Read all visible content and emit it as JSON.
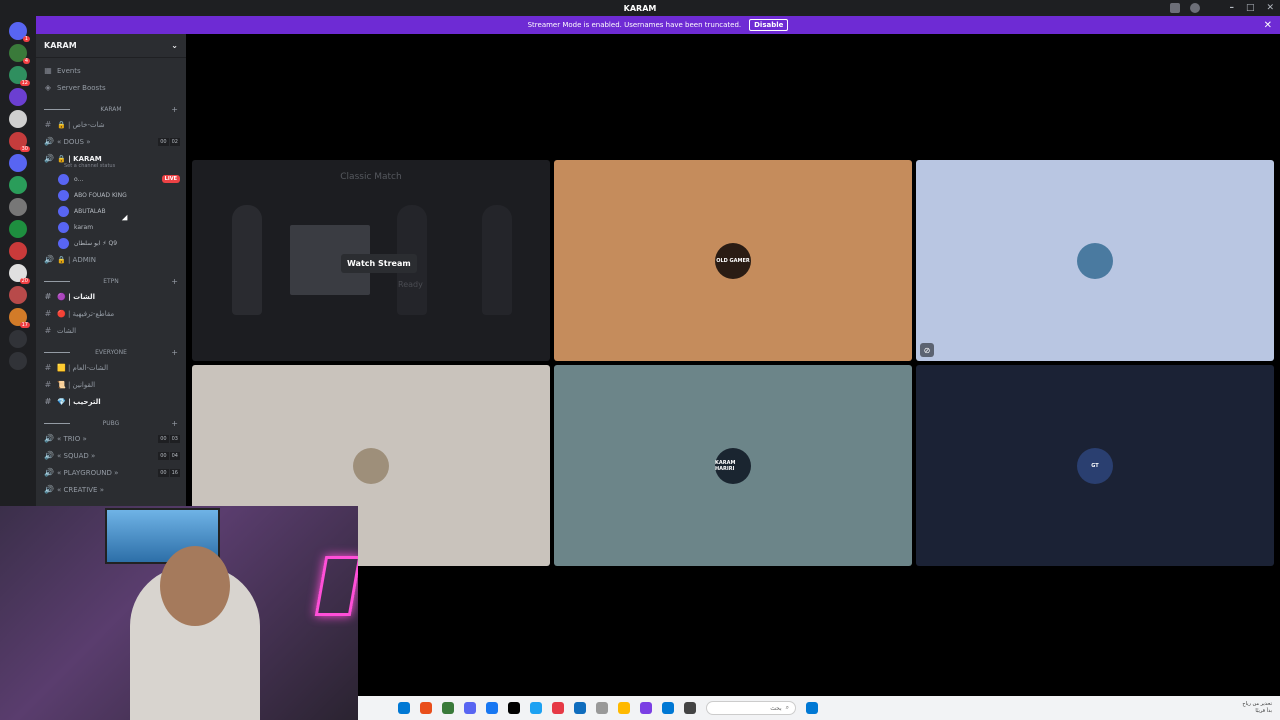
{
  "window": {
    "title": "KARAM"
  },
  "banner": {
    "text": "Streamer Mode is enabled. Usernames have been truncated.",
    "disable_label": "Disable"
  },
  "guilds": [
    {
      "color": "#5865f2",
      "badge": "1"
    },
    {
      "color": "#3a7a3a",
      "badge": "4"
    },
    {
      "color": "#2f8f5f",
      "badge": "12"
    },
    {
      "color": "#6b3fd1",
      "badge": ""
    },
    {
      "color": "#cfcfcf",
      "badge": ""
    },
    {
      "color": "#c43c3c",
      "badge": "30"
    },
    {
      "color": "#5865f2",
      "badge": ""
    },
    {
      "color": "#2a9d5a",
      "badge": ""
    },
    {
      "color": "#777",
      "badge": ""
    },
    {
      "color": "#1e8f3f",
      "badge": ""
    },
    {
      "color": "#c93a3a",
      "badge": ""
    },
    {
      "color": "#e0e0e0",
      "badge": "20"
    },
    {
      "color": "#b84a4a",
      "badge": ""
    },
    {
      "color": "#d27b28",
      "badge": "17"
    },
    {
      "color": "#313338",
      "badge": ""
    },
    {
      "color": "#313338",
      "badge": ""
    }
  ],
  "sidebar": {
    "server_name": "KARAM",
    "top_items": [
      {
        "icon": "calendar-icon",
        "label": "Events"
      },
      {
        "icon": "boost-icon",
        "label": "Server Boosts"
      }
    ],
    "categories": [
      {
        "name": "KARAM",
        "channels": [
          {
            "type": "text",
            "label": "🔒 | شات-خاص",
            "bright": false,
            "counts": []
          },
          {
            "type": "voice",
            "label": "« DOUS »",
            "bright": false,
            "counts": [
              "00",
              "02"
            ]
          },
          {
            "type": "voice",
            "label": "🔒 | KARAM",
            "bright": true,
            "counts": [],
            "status": "Set a channel status",
            "users": [
              {
                "name": "o...",
                "live": true
              },
              {
                "name": "ABO FOUAD KING",
                "live": false
              },
              {
                "name": "ABUTALAB",
                "live": false
              },
              {
                "name": "karam",
                "live": false
              },
              {
                "name": "ابو سلطان ⚡ Q9",
                "live": false
              }
            ]
          },
          {
            "type": "voice",
            "label": "🔒 | ADMIN",
            "bright": false,
            "counts": []
          }
        ]
      },
      {
        "name": "ETPN",
        "channels": [
          {
            "type": "text",
            "label": "🟣 | الشات",
            "bright": true,
            "counts": []
          },
          {
            "type": "text",
            "label": "🔴 | مقاطع-ترفيهية",
            "bright": false,
            "counts": []
          },
          {
            "type": "text",
            "label": "الشات",
            "bright": false,
            "counts": []
          }
        ]
      },
      {
        "name": "EVERYONE",
        "channels": [
          {
            "type": "text",
            "label": "🟨 | الشات-العام",
            "bright": false,
            "counts": []
          },
          {
            "type": "text",
            "label": "📜 | القوانين",
            "bright": false,
            "counts": []
          },
          {
            "type": "text",
            "label": "💎 | الترحيب",
            "bright": true,
            "counts": []
          }
        ]
      },
      {
        "name": "PUBG",
        "channels": [
          {
            "type": "voice",
            "label": "« TRIO »",
            "bright": false,
            "counts": [
              "00",
              "03"
            ]
          },
          {
            "type": "voice",
            "label": "« SQUAD »",
            "bright": false,
            "counts": [
              "00",
              "04"
            ]
          },
          {
            "type": "voice",
            "label": "« PLAYGROUND »",
            "bright": false,
            "counts": [
              "00",
              "16"
            ]
          },
          {
            "type": "voice",
            "label": "« CREATIVE »",
            "bright": false,
            "counts": []
          }
        ]
      }
    ]
  },
  "stream": {
    "title": "Classic Match",
    "watch_label": "Watch Stream",
    "ready_text": "Ready"
  },
  "tiles": [
    {
      "bg": "#c58c5c",
      "avatar_color": "#2a1c14",
      "avatar_text": "OLD GAMER",
      "muted": false
    },
    {
      "bg": "#b9c6e2",
      "avatar_color": "#4a7aa0",
      "avatar_text": "",
      "muted": true
    },
    {
      "bg": "#c9c3bc",
      "avatar_color": "#9e8f7a",
      "avatar_text": "",
      "muted": false
    },
    {
      "bg": "#6c8589",
      "avatar_color": "#1a2530",
      "avatar_text": "KARAM HARIRI",
      "muted": false
    },
    {
      "bg": "#1b2235",
      "avatar_color": "#2a3f70",
      "avatar_text": "GT",
      "muted": false
    }
  ],
  "taskbar": {
    "search_placeholder": "بحث",
    "tray_line1": "تحذير من رياح",
    "tray_line2": "بدأ قريبًا",
    "icons": [
      "#0078d4",
      "#e94e1b",
      "#3a7a3a",
      "#5865f2",
      "#1877f2",
      "#000",
      "#1da1f2",
      "#e63946",
      "#0f6cbd",
      "#999",
      "#ffb900",
      "#7b3fe4",
      "#0078d4",
      "#444"
    ]
  }
}
